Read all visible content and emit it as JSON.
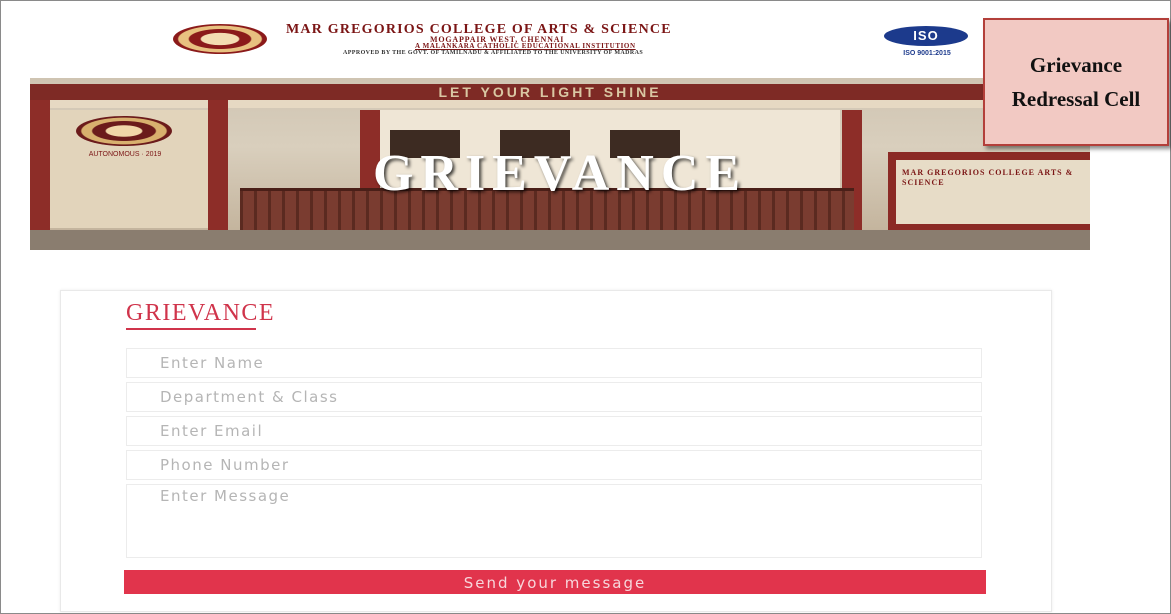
{
  "header": {
    "college_name": "MAR GREGORIOS COLLEGE OF ARTS & SCIENCE",
    "location": "MOGAPPAIR WEST, CHENNAI",
    "institution_type": "A MALANKARA CATHOLIC EDUCATIONAL INSTITUTION",
    "affiliation": "APPROVED BY THE GOVT. OF TAMILNADU & AFFILIATED TO THE UNIVERSITY OF MADRAS",
    "iso_label": "ISO",
    "iso_standard": "ISO 9001:2015"
  },
  "callout": {
    "text": "Grievance Redressal Cell"
  },
  "banner": {
    "slogan": "LET YOUR LIGHT SHINE",
    "title": "GRIEVANCE",
    "wall_text": "MAR GREGORIOS COLLEGE ARTS & SCIENCE",
    "emblem_caption": "AUTONOMOUS · 2019"
  },
  "form": {
    "heading": "GRIEVANCE",
    "fields": [
      {
        "placeholder": "Enter Name"
      },
      {
        "placeholder": "Department & Class"
      },
      {
        "placeholder": "Enter Email"
      },
      {
        "placeholder": "Phone Number"
      }
    ],
    "message_placeholder": "Enter Message",
    "submit_label": "Send your message"
  },
  "colors": {
    "accent": "#e1344c",
    "brand_maroon": "#7b1515",
    "callout_bg": "#f2c9c3"
  }
}
